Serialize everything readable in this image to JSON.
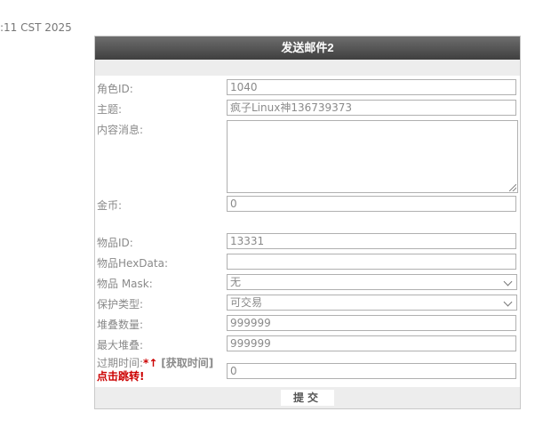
{
  "timestamp": ":11 CST 2025",
  "form": {
    "title": "发送邮件2",
    "role_id": {
      "label": "角色ID:",
      "value": "1040"
    },
    "subject": {
      "label": "主题:",
      "value": "疯子Linux神136739373"
    },
    "content": {
      "label": "内容消息:",
      "value": ""
    },
    "gold": {
      "label": "金币:",
      "value": "0"
    },
    "item_id": {
      "label": "物品ID:",
      "value": "13331"
    },
    "hex_data": {
      "label": "物品HexData:",
      "value": ""
    },
    "item_mask": {
      "label": "物品 Mask:",
      "value": "无"
    },
    "protect_type": {
      "label": "保护类型:",
      "value": "可交易"
    },
    "stack_count": {
      "label": "堆叠数量:",
      "value": "999999"
    },
    "max_stack": {
      "label": "最大堆叠:",
      "value": "999999"
    },
    "expire": {
      "label": "过期时间:",
      "required_mark": "*↑",
      "get_time_link": "[获取时间]",
      "jump_link": "点击跳转!",
      "value": "0"
    },
    "submit_label": "提交"
  }
}
